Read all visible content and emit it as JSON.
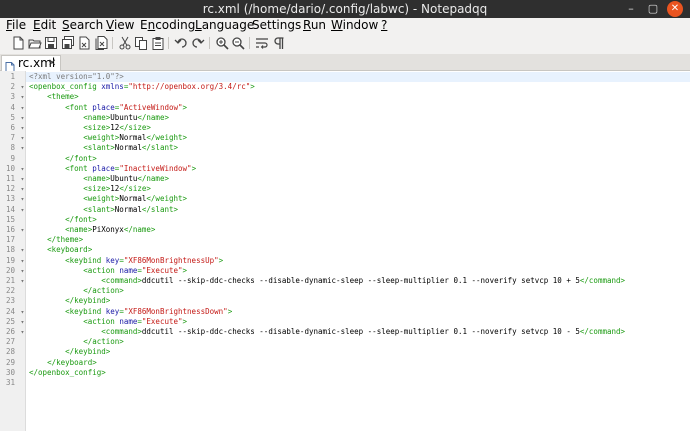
{
  "window": {
    "title": "rc.xml (/home/dario/.config/labwc) - Notepadqq",
    "controls": {
      "minimize": "–",
      "maximize": "▢",
      "close": "✕"
    }
  },
  "menubar": [
    {
      "label": "File",
      "mnemonic": "F"
    },
    {
      "label": "Edit",
      "mnemonic": "E"
    },
    {
      "label": "Search",
      "mnemonic": "S"
    },
    {
      "label": "View",
      "mnemonic": "V"
    },
    {
      "label": "Encoding",
      "mnemonic": "n"
    },
    {
      "label": "Language",
      "mnemonic": "L"
    },
    {
      "label": "Settings",
      "mnemonic": ""
    },
    {
      "label": "Run",
      "mnemonic": "R"
    },
    {
      "label": "Window",
      "mnemonic": "W"
    },
    {
      "label": "?",
      "mnemonic": "?"
    }
  ],
  "toolbar": [
    {
      "name": "new-file-icon"
    },
    {
      "name": "open-file-icon"
    },
    {
      "name": "save-icon"
    },
    {
      "name": "save-all-icon"
    },
    {
      "name": "close-file-icon"
    },
    {
      "name": "close-all-icon"
    },
    {
      "sep": true
    },
    {
      "name": "cut-icon"
    },
    {
      "name": "copy-icon"
    },
    {
      "name": "paste-icon"
    },
    {
      "sep": true
    },
    {
      "name": "undo-icon"
    },
    {
      "name": "redo-icon"
    },
    {
      "sep": true
    },
    {
      "name": "zoom-in-icon"
    },
    {
      "name": "zoom-out-icon"
    },
    {
      "sep": true
    },
    {
      "name": "word-wrap-icon"
    },
    {
      "name": "show-all-characters-icon"
    }
  ],
  "tabs": [
    {
      "label": "rc.xml",
      "close": "✕",
      "active": true
    }
  ],
  "editor": {
    "current_line": 1,
    "lines": [
      {
        "n": "1",
        "fold": "",
        "ind": 0,
        "tokens": [
          [
            "pi",
            "<?xml version=\"1.0\"?>"
          ]
        ]
      },
      {
        "n": "2",
        "fold": "▾",
        "ind": 0,
        "tokens": [
          [
            "tag",
            "<openbox_config "
          ],
          [
            "attr",
            "xmlns"
          ],
          [
            "tag",
            "="
          ],
          [
            "str",
            "\"http://openbox.org/3.4/rc\""
          ],
          [
            "tag",
            ">"
          ]
        ]
      },
      {
        "n": "3",
        "fold": "▾",
        "ind": 1,
        "tokens": [
          [
            "tag",
            "<theme>"
          ]
        ]
      },
      {
        "n": "4",
        "fold": "▾",
        "ind": 2,
        "tokens": [
          [
            "tag",
            "<font "
          ],
          [
            "attr",
            "place"
          ],
          [
            "tag",
            "="
          ],
          [
            "str",
            "\"ActiveWindow\""
          ],
          [
            "tag",
            ">"
          ]
        ]
      },
      {
        "n": "5",
        "fold": "▾",
        "ind": 3,
        "tokens": [
          [
            "tag",
            "<name>"
          ],
          [
            "text",
            "Ubuntu"
          ],
          [
            "tag",
            "</name>"
          ]
        ]
      },
      {
        "n": "6",
        "fold": "▾",
        "ind": 3,
        "tokens": [
          [
            "tag",
            "<size>"
          ],
          [
            "text",
            "12"
          ],
          [
            "tag",
            "</size>"
          ]
        ]
      },
      {
        "n": "7",
        "fold": "▾",
        "ind": 3,
        "tokens": [
          [
            "tag",
            "<weight>"
          ],
          [
            "text",
            "Normal"
          ],
          [
            "tag",
            "</weight>"
          ]
        ]
      },
      {
        "n": "8",
        "fold": "▾",
        "ind": 3,
        "tokens": [
          [
            "tag",
            "<slant>"
          ],
          [
            "text",
            "Normal"
          ],
          [
            "tag",
            "</slant>"
          ]
        ]
      },
      {
        "n": "9",
        "fold": "",
        "ind": 2,
        "tokens": [
          [
            "tag",
            "</font>"
          ]
        ]
      },
      {
        "n": "10",
        "fold": "▾",
        "ind": 2,
        "tokens": [
          [
            "tag",
            "<font "
          ],
          [
            "attr",
            "place"
          ],
          [
            "tag",
            "="
          ],
          [
            "str",
            "\"InactiveWindow\""
          ],
          [
            "tag",
            ">"
          ]
        ]
      },
      {
        "n": "11",
        "fold": "▾",
        "ind": 3,
        "tokens": [
          [
            "tag",
            "<name>"
          ],
          [
            "text",
            "Ubuntu"
          ],
          [
            "tag",
            "</name>"
          ]
        ]
      },
      {
        "n": "12",
        "fold": "▾",
        "ind": 3,
        "tokens": [
          [
            "tag",
            "<size>"
          ],
          [
            "text",
            "12"
          ],
          [
            "tag",
            "</size>"
          ]
        ]
      },
      {
        "n": "13",
        "fold": "▾",
        "ind": 3,
        "tokens": [
          [
            "tag",
            "<weight>"
          ],
          [
            "text",
            "Normal"
          ],
          [
            "tag",
            "</weight>"
          ]
        ]
      },
      {
        "n": "14",
        "fold": "▾",
        "ind": 3,
        "tokens": [
          [
            "tag",
            "<slant>"
          ],
          [
            "text",
            "Normal"
          ],
          [
            "tag",
            "</slant>"
          ]
        ]
      },
      {
        "n": "15",
        "fold": "",
        "ind": 2,
        "tokens": [
          [
            "tag",
            "</font>"
          ]
        ]
      },
      {
        "n": "16",
        "fold": "▾",
        "ind": 2,
        "tokens": [
          [
            "tag",
            "<name>"
          ],
          [
            "text",
            "PiXonyx"
          ],
          [
            "tag",
            "</name>"
          ]
        ]
      },
      {
        "n": "17",
        "fold": "",
        "ind": 1,
        "tokens": [
          [
            "tag",
            "</theme>"
          ]
        ]
      },
      {
        "n": "18",
        "fold": "▾",
        "ind": 1,
        "tokens": [
          [
            "tag",
            "<keyboard>"
          ]
        ]
      },
      {
        "n": "19",
        "fold": "▾",
        "ind": 2,
        "tokens": [
          [
            "tag",
            "<keybind "
          ],
          [
            "attr",
            "key"
          ],
          [
            "tag",
            "="
          ],
          [
            "str",
            "\"XF86MonBrightnessUp\""
          ],
          [
            "tag",
            ">"
          ]
        ]
      },
      {
        "n": "20",
        "fold": "▾",
        "ind": 3,
        "tokens": [
          [
            "tag",
            "<action "
          ],
          [
            "attr",
            "name"
          ],
          [
            "tag",
            "="
          ],
          [
            "str",
            "\"Execute\""
          ],
          [
            "tag",
            ">"
          ]
        ]
      },
      {
        "n": "21",
        "fold": "▾",
        "ind": 4,
        "tokens": [
          [
            "tag",
            "<command>"
          ],
          [
            "text",
            "ddcutil --skip-ddc-checks --disable-dynamic-sleep --sleep-multiplier 0.1 --noverify setvcp 10 + 5"
          ],
          [
            "tag",
            "</command>"
          ]
        ]
      },
      {
        "n": "22",
        "fold": "",
        "ind": 3,
        "tokens": [
          [
            "tag",
            "</action>"
          ]
        ]
      },
      {
        "n": "23",
        "fold": "",
        "ind": 2,
        "tokens": [
          [
            "tag",
            "</keybind>"
          ]
        ]
      },
      {
        "n": "24",
        "fold": "▾",
        "ind": 2,
        "tokens": [
          [
            "tag",
            "<keybind "
          ],
          [
            "attr",
            "key"
          ],
          [
            "tag",
            "="
          ],
          [
            "str",
            "\"XF86MonBrightnessDown\""
          ],
          [
            "tag",
            ">"
          ]
        ]
      },
      {
        "n": "25",
        "fold": "▾",
        "ind": 3,
        "tokens": [
          [
            "tag",
            "<action "
          ],
          [
            "attr",
            "name"
          ],
          [
            "tag",
            "="
          ],
          [
            "str",
            "\"Execute\""
          ],
          [
            "tag",
            ">"
          ]
        ]
      },
      {
        "n": "26",
        "fold": "▾",
        "ind": 4,
        "tokens": [
          [
            "tag",
            "<command>"
          ],
          [
            "text",
            "ddcutil --skip-ddc-checks --disable-dynamic-sleep --sleep-multiplier 0.1 --noverify setvcp 10 - 5"
          ],
          [
            "tag",
            "</command>"
          ]
        ]
      },
      {
        "n": "27",
        "fold": "",
        "ind": 3,
        "tokens": [
          [
            "tag",
            "</action>"
          ]
        ]
      },
      {
        "n": "28",
        "fold": "",
        "ind": 2,
        "tokens": [
          [
            "tag",
            "</keybind>"
          ]
        ]
      },
      {
        "n": "29",
        "fold": "",
        "ind": 1,
        "tokens": [
          [
            "tag",
            "</keyboard>"
          ]
        ]
      },
      {
        "n": "30",
        "fold": "",
        "ind": 0,
        "tokens": [
          [
            "tag",
            "</openbox_config>"
          ]
        ]
      },
      {
        "n": "31",
        "fold": "",
        "ind": 0,
        "tokens": []
      }
    ]
  },
  "colors": {
    "titlebar": "#2f2f2f",
    "chrome": "#f2f1f0",
    "close_button": "#e95420",
    "tag": "#1a9a10",
    "attribute": "#1a1aa6",
    "string": "#c41a16",
    "current_line": "#e8f2fe"
  }
}
